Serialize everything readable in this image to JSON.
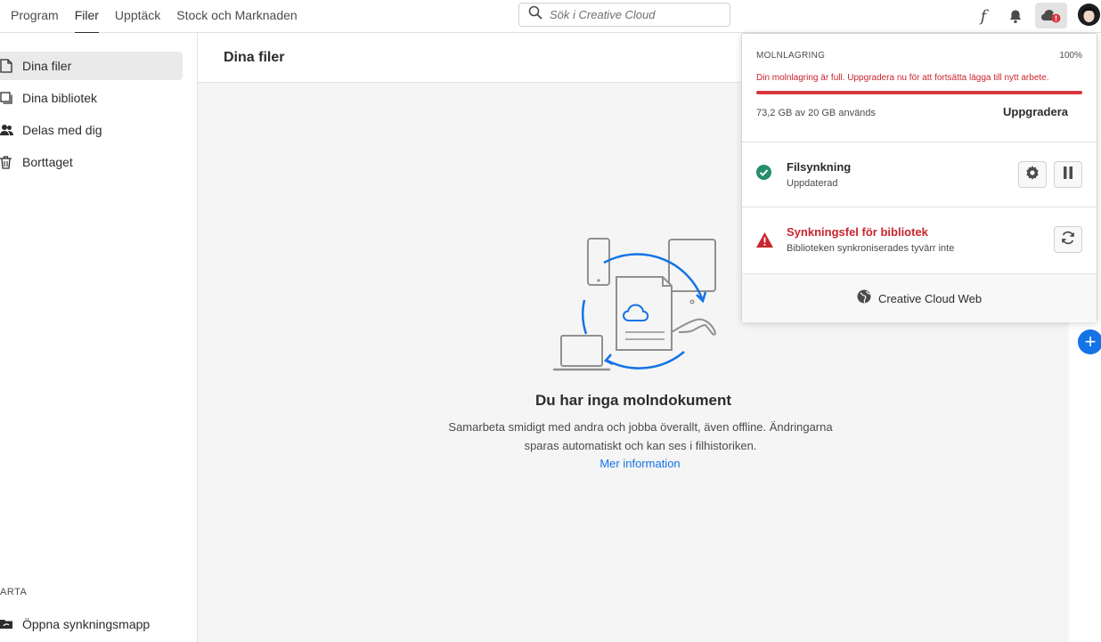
{
  "nav": {
    "tabs": [
      {
        "label": "Program"
      },
      {
        "label": "Filer"
      },
      {
        "label": "Upptäck"
      },
      {
        "label": "Stock och Marknaden"
      }
    ],
    "active": "Filer"
  },
  "search": {
    "placeholder": "Sök i Creative Cloud"
  },
  "topbar_icons": [
    "fonts-icon",
    "bell-icon",
    "cloud-alert-icon",
    "avatar"
  ],
  "sidebar": {
    "items": [
      {
        "label": "Dina filer",
        "icon": "file-icon"
      },
      {
        "label": "Dina bibliotek",
        "icon": "library-icon"
      },
      {
        "label": "Delas med dig",
        "icon": "people-icon"
      },
      {
        "label": "Borttaget",
        "icon": "trash-icon"
      }
    ],
    "section_label": "ARTA",
    "bottom_item": {
      "label": "Öppna synkningsmapp",
      "icon": "folder-sync-icon"
    }
  },
  "main": {
    "title": "Dina filer",
    "empty_title": "Du har inga molndokument",
    "empty_desc": "Samarbeta smidigt med andra och jobba överallt, även offline. Ändringarna sparas automatiskt och kan ses i filhistoriken.",
    "empty_link": "Mer information"
  },
  "popover": {
    "storage": {
      "title": "MOLNLAGRING",
      "percent_label": "100%",
      "percent_value": 1.0,
      "message": "Din molnlagring är full. Uppgradera nu för att fortsätta lägga till nytt arbete.",
      "usage": "73,2 GB av 20 GB används",
      "upgrade_label": "Uppgradera"
    },
    "file_sync": {
      "title": "Filsynkning",
      "status": "Uppdaterad"
    },
    "library_error": {
      "title": "Synkningsfel för bibliotek",
      "message": "Biblioteken synkroniserades tyvärr inte"
    },
    "web_link": "Creative Cloud Web"
  },
  "colors": {
    "accent": "#1473e6",
    "error": "#c9252d",
    "success": "#268e6c",
    "bar_fill": "#d7373f"
  }
}
